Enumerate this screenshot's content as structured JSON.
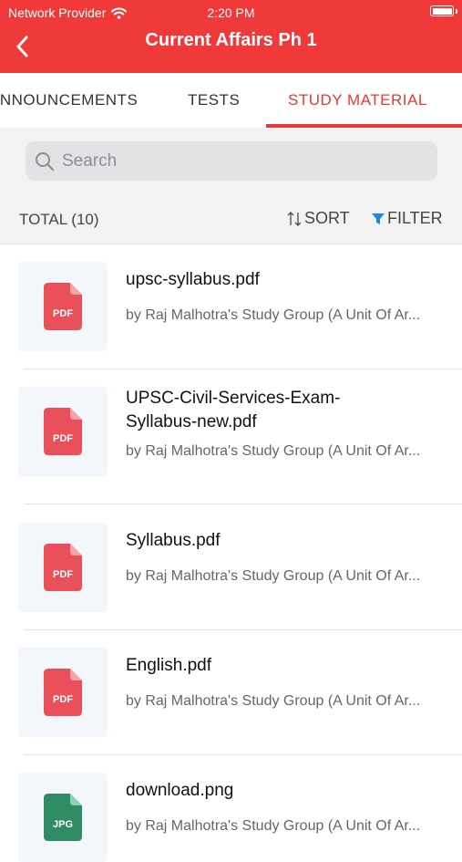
{
  "status": {
    "carrier": "Network Provider",
    "time": "2:20 PM"
  },
  "header": {
    "title": "Current Affairs Ph 1"
  },
  "tabs": [
    {
      "label": "ANNOUNCEMENTS"
    },
    {
      "label": "TESTS"
    },
    {
      "label": "STUDY MATERIAL",
      "active": true
    }
  ],
  "search": {
    "placeholder": "Search"
  },
  "toolbar": {
    "total": "TOTAL (10)",
    "sort_label": "SORT",
    "filter_label": "FILTER"
  },
  "files": [
    {
      "name": "upsc-syllabus.pdf",
      "by": "by Raj Malhotra's Study Group (A Unit Of Ar...",
      "type": "PDF",
      "icon": "pdf-file-icon"
    },
    {
      "name": "UPSC-Civil-Services-Exam-Syllabus-new.pdf",
      "by": "by Raj Malhotra's Study Group (A Unit Of Ar...",
      "type": "PDF",
      "icon": "pdf-file-icon"
    },
    {
      "name": "Syllabus.pdf",
      "by": "by Raj Malhotra's Study Group (A Unit Of Ar...",
      "type": "PDF",
      "icon": "pdf-file-icon"
    },
    {
      "name": "English.pdf",
      "by": "by Raj Malhotra's Study Group (A Unit Of Ar...",
      "type": "PDF",
      "icon": "pdf-file-icon"
    },
    {
      "name": "download.png",
      "by": "by Raj Malhotra's Study Group (A Unit Of Ar...",
      "type": "JPG",
      "icon": "image-file-icon"
    }
  ],
  "colors": {
    "header": "#f03a3a",
    "accent": "#e53935",
    "pdf": "#e9505a",
    "image": "#2e8b63",
    "filter_icon": "#1e88e5"
  }
}
